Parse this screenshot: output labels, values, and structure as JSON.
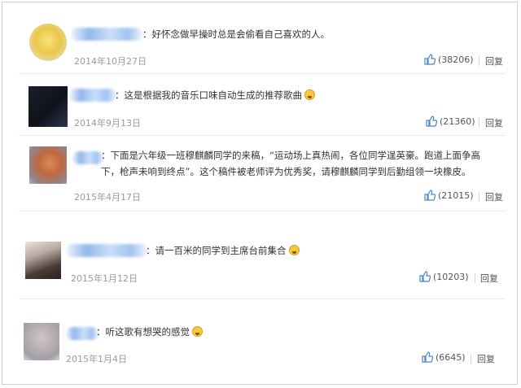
{
  "comments": [
    {
      "text": "：好怀念做早操时总是会偷看自己喜欢的人。",
      "date": "2014年10月27日",
      "likes": "(38206)",
      "reply": "回复",
      "emoji": ""
    },
    {
      "text": "：这是根据我的音乐口味自动生成的推荐歌曲",
      "date": "2014年9月13日",
      "likes": "(21360)",
      "reply": "回复",
      "emoji": "scared-face-emoji"
    },
    {
      "text": "：下面是六年级一班穆麒麟同学的来稿，“运动场上真热闹，各位同学逞英豪。跑道上面争高下，枪声未响到终点”。这个稿件被老师评为优秀奖，请穆麒麟同学到后勤组领一块橡皮。",
      "date": "2015年4月17日",
      "likes": "(21015)",
      "reply": "回复",
      "emoji": ""
    },
    {
      "text": "：请一百米的同学到主席台前集合",
      "date": "2015年1月12日",
      "likes": "(10203)",
      "reply": "回复",
      "emoji": "laughing-crying-emoji"
    },
    {
      "text": "：听这歌有想哭的感觉",
      "date": "2015年1月4日",
      "likes": "(6645)",
      "reply": "回复",
      "emoji": "crying-emoji"
    }
  ],
  "colors": {
    "name_blur": "#7aa9e8",
    "date": "#9a9a9a",
    "like_icon": "#4a86c8",
    "separator": "#ececec"
  }
}
